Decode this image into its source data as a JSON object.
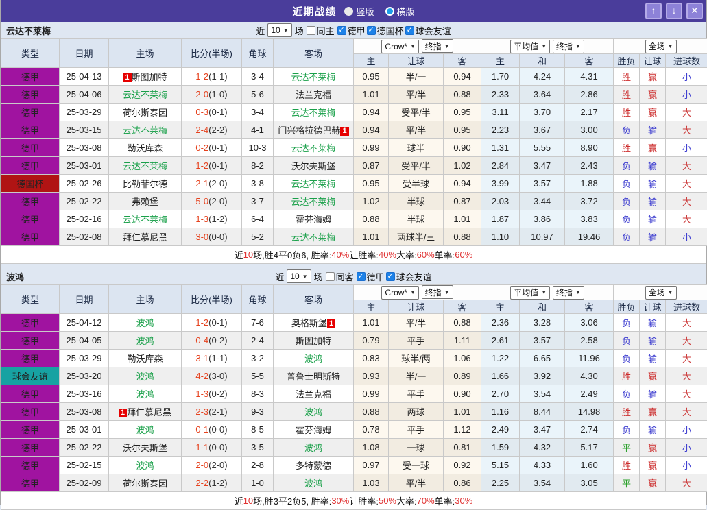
{
  "topbar": {
    "title": "近期战绩",
    "view_options": [
      {
        "label": "竖版",
        "selected": false
      },
      {
        "label": "横版",
        "selected": true
      }
    ],
    "buttons": {
      "up": "↑",
      "down": "↓",
      "close": "✕"
    }
  },
  "colors": {
    "topbar_purple": "#4a3d9b",
    "types": {
      "德甲": "#a013a0",
      "德国杯": "#b01414",
      "球会友谊": "#17a2a2"
    },
    "status": {
      "胜": "#cc2b2b",
      "赢": "#cc2b2b",
      "大": "#cc3b3b",
      "负": "#3b3bcf",
      "输": "#3b3bcf",
      "小": "#3b3bcf",
      "平": "#2ba02b"
    },
    "score_red": "#e6421e",
    "team_green": "#19a049",
    "summary_red": "#e03333",
    "checkbox_blue": "#1e82e8"
  },
  "sections": [
    {
      "team": "云达不莱梅",
      "filter": {
        "near_label": "近",
        "games_value": "10",
        "games_label": "场",
        "same_label": "同主",
        "same_checked": false,
        "leagues": [
          {
            "label": "德甲",
            "checked": true
          },
          {
            "label": "德国杯",
            "checked": true
          },
          {
            "label": "球会友谊",
            "checked": true
          }
        ]
      },
      "header": {
        "cols": [
          "类型",
          "日期",
          "主场",
          "比分(半场)",
          "角球",
          "客场"
        ],
        "crow_select": "Crow*",
        "crow_final": "终指",
        "crow_cols": [
          "主",
          "让球",
          "客"
        ],
        "avg_select": "平均值",
        "avg_final": "终指",
        "avg_cols": [
          "主",
          "和",
          "客"
        ],
        "full_select": "全场",
        "result_cols": [
          "胜负",
          "让球",
          "进球数"
        ]
      },
      "rows": [
        {
          "type": "德甲",
          "date": "25-04-13",
          "home": "斯图加特",
          "hb": "1",
          "hbs": "l",
          "hg": false,
          "score": "1-2",
          "half": "(1-1)",
          "corner": "3-4",
          "away": "云达不莱梅",
          "ag": true,
          "odds": [
            "0.95",
            "半/一",
            "0.94"
          ],
          "avg": [
            "1.70",
            "4.24",
            "4.31"
          ],
          "res": [
            "胜",
            "赢",
            "小"
          ]
        },
        {
          "type": "德甲",
          "date": "25-04-06",
          "home": "云达不莱梅",
          "hg": true,
          "score": "2-0",
          "half": "(1-0)",
          "corner": "5-6",
          "away": "法兰克福",
          "ag": false,
          "odds": [
            "1.01",
            "平/半",
            "0.88"
          ],
          "avg": [
            "2.33",
            "3.64",
            "2.86"
          ],
          "res": [
            "胜",
            "赢",
            "小"
          ]
        },
        {
          "type": "德甲",
          "date": "25-03-29",
          "home": "荷尔斯泰因",
          "hg": false,
          "score": "0-3",
          "half": "(0-1)",
          "corner": "3-4",
          "away": "云达不莱梅",
          "ag": true,
          "odds": [
            "0.94",
            "受平/半",
            "0.95"
          ],
          "avg": [
            "3.11",
            "3.70",
            "2.17"
          ],
          "res": [
            "胜",
            "赢",
            "大"
          ]
        },
        {
          "type": "德甲",
          "date": "25-03-15",
          "home": "云达不莱梅",
          "hg": true,
          "score": "2-4",
          "half": "(2-2)",
          "corner": "4-1",
          "away": "门兴格拉德巴赫",
          "ab": "1",
          "abs": "r",
          "ag": false,
          "odds": [
            "0.94",
            "平/半",
            "0.95"
          ],
          "avg": [
            "2.23",
            "3.67",
            "3.00"
          ],
          "res": [
            "负",
            "输",
            "大"
          ]
        },
        {
          "type": "德甲",
          "date": "25-03-08",
          "home": "勒沃库森",
          "hg": false,
          "score": "0-2",
          "half": "(0-1)",
          "corner": "10-3",
          "away": "云达不莱梅",
          "ag": true,
          "odds": [
            "0.99",
            "球半",
            "0.90"
          ],
          "avg": [
            "1.31",
            "5.55",
            "8.90"
          ],
          "res": [
            "胜",
            "赢",
            "小"
          ]
        },
        {
          "type": "德甲",
          "date": "25-03-01",
          "home": "云达不莱梅",
          "hg": true,
          "score": "1-2",
          "half": "(0-1)",
          "corner": "8-2",
          "away": "沃尔夫斯堡",
          "ag": false,
          "odds": [
            "0.87",
            "受平/半",
            "1.02"
          ],
          "avg": [
            "2.84",
            "3.47",
            "2.43"
          ],
          "res": [
            "负",
            "输",
            "大"
          ]
        },
        {
          "type": "德国杯",
          "date": "25-02-26",
          "home": "比勒菲尔德",
          "hg": false,
          "score": "2-1",
          "half": "(2-0)",
          "corner": "3-8",
          "away": "云达不莱梅",
          "ag": true,
          "odds": [
            "0.95",
            "受半球",
            "0.94"
          ],
          "avg": [
            "3.99",
            "3.57",
            "1.88"
          ],
          "res": [
            "负",
            "输",
            "大"
          ]
        },
        {
          "type": "德甲",
          "date": "25-02-22",
          "home": "弗赖堡",
          "hg": false,
          "score": "5-0",
          "half": "(2-0)",
          "corner": "3-7",
          "away": "云达不莱梅",
          "ag": true,
          "odds": [
            "1.02",
            "半球",
            "0.87"
          ],
          "avg": [
            "2.03",
            "3.44",
            "3.72"
          ],
          "res": [
            "负",
            "输",
            "大"
          ]
        },
        {
          "type": "德甲",
          "date": "25-02-16",
          "home": "云达不莱梅",
          "hg": true,
          "score": "1-3",
          "half": "(1-2)",
          "corner": "6-4",
          "away": "霍芬海姆",
          "ag": false,
          "odds": [
            "0.88",
            "半球",
            "1.01"
          ],
          "avg": [
            "1.87",
            "3.86",
            "3.83"
          ],
          "res": [
            "负",
            "输",
            "大"
          ]
        },
        {
          "type": "德甲",
          "date": "25-02-08",
          "home": "拜仁慕尼黑",
          "hg": false,
          "score": "3-0",
          "half": "(0-0)",
          "corner": "5-2",
          "away": "云达不莱梅",
          "ag": true,
          "odds": [
            "1.01",
            "两球半/三",
            "0.88"
          ],
          "avg": [
            "1.10",
            "10.97",
            "19.46"
          ],
          "res": [
            "负",
            "输",
            "小"
          ]
        }
      ],
      "summary": [
        {
          "t": "近"
        },
        {
          "t": "10",
          "red": true
        },
        {
          "t": "场,胜4平0负6, 胜率:"
        },
        {
          "t": "40%",
          "red": true
        },
        {
          "t": " 让胜率:"
        },
        {
          "t": "40%",
          "red": true
        },
        {
          "t": " 大率:"
        },
        {
          "t": "60%",
          "red": true
        },
        {
          "t": " 单率:"
        },
        {
          "t": "60%",
          "red": true
        }
      ]
    },
    {
      "team": "波鸿",
      "filter": {
        "near_label": "近",
        "games_value": "10",
        "games_label": "场",
        "same_label": "同客",
        "same_checked": false,
        "leagues": [
          {
            "label": "德甲",
            "checked": true
          },
          {
            "label": "球会友谊",
            "checked": true
          }
        ]
      },
      "header": {
        "cols": [
          "类型",
          "日期",
          "主场",
          "比分(半场)",
          "角球",
          "客场"
        ],
        "crow_select": "Crow*",
        "crow_final": "终指",
        "crow_cols": [
          "主",
          "让球",
          "客"
        ],
        "avg_select": "平均值",
        "avg_final": "终指",
        "avg_cols": [
          "主",
          "和",
          "客"
        ],
        "full_select": "全场",
        "result_cols": [
          "胜负",
          "让球",
          "进球数"
        ]
      },
      "rows": [
        {
          "type": "德甲",
          "date": "25-04-12",
          "home": "波鸿",
          "hg": true,
          "score": "1-2",
          "half": "(0-1)",
          "corner": "7-6",
          "away": "奥格斯堡",
          "ab": "1",
          "abs": "r",
          "ag": false,
          "odds": [
            "1.01",
            "平/半",
            "0.88"
          ],
          "avg": [
            "2.36",
            "3.28",
            "3.06"
          ],
          "res": [
            "负",
            "输",
            "大"
          ]
        },
        {
          "type": "德甲",
          "date": "25-04-05",
          "home": "波鸿",
          "hg": true,
          "score": "0-4",
          "half": "(0-2)",
          "corner": "2-4",
          "away": "斯图加特",
          "ag": false,
          "odds": [
            "0.79",
            "平手",
            "1.11"
          ],
          "avg": [
            "2.61",
            "3.57",
            "2.58"
          ],
          "res": [
            "负",
            "输",
            "大"
          ]
        },
        {
          "type": "德甲",
          "date": "25-03-29",
          "home": "勒沃库森",
          "hg": false,
          "score": "3-1",
          "half": "(1-1)",
          "corner": "3-2",
          "away": "波鸿",
          "ag": true,
          "odds": [
            "0.83",
            "球半/两",
            "1.06"
          ],
          "avg": [
            "1.22",
            "6.65",
            "11.96"
          ],
          "res": [
            "负",
            "输",
            "大"
          ]
        },
        {
          "type": "球会友谊",
          "date": "25-03-20",
          "home": "波鸿",
          "hg": true,
          "score": "4-2",
          "half": "(3-0)",
          "corner": "5-5",
          "away": "普鲁士明斯特",
          "ag": false,
          "odds": [
            "0.93",
            "半/一",
            "0.89"
          ],
          "avg": [
            "1.66",
            "3.92",
            "4.30"
          ],
          "res": [
            "胜",
            "赢",
            "大"
          ]
        },
        {
          "type": "德甲",
          "date": "25-03-16",
          "home": "波鸿",
          "hg": true,
          "score": "1-3",
          "half": "(0-2)",
          "corner": "8-3",
          "away": "法兰克福",
          "ag": false,
          "odds": [
            "0.99",
            "平手",
            "0.90"
          ],
          "avg": [
            "2.70",
            "3.54",
            "2.49"
          ],
          "res": [
            "负",
            "输",
            "大"
          ]
        },
        {
          "type": "德甲",
          "date": "25-03-08",
          "home": "拜仁慕尼黑",
          "hb": "1",
          "hbs": "l",
          "hg": false,
          "score": "2-3",
          "half": "(2-1)",
          "corner": "9-3",
          "away": "波鸿",
          "ag": true,
          "odds": [
            "0.88",
            "两球",
            "1.01"
          ],
          "avg": [
            "1.16",
            "8.44",
            "14.98"
          ],
          "res": [
            "胜",
            "赢",
            "大"
          ]
        },
        {
          "type": "德甲",
          "date": "25-03-01",
          "home": "波鸿",
          "hg": true,
          "score": "0-1",
          "half": "(0-0)",
          "corner": "8-5",
          "away": "霍芬海姆",
          "ag": false,
          "odds": [
            "0.78",
            "平手",
            "1.12"
          ],
          "avg": [
            "2.49",
            "3.47",
            "2.74"
          ],
          "res": [
            "负",
            "输",
            "小"
          ]
        },
        {
          "type": "德甲",
          "date": "25-02-22",
          "home": "沃尔夫斯堡",
          "hg": false,
          "score": "1-1",
          "half": "(0-0)",
          "corner": "3-5",
          "away": "波鸿",
          "ag": true,
          "odds": [
            "1.08",
            "一球",
            "0.81"
          ],
          "avg": [
            "1.59",
            "4.32",
            "5.17"
          ],
          "res": [
            "平",
            "赢",
            "小"
          ]
        },
        {
          "type": "德甲",
          "date": "25-02-15",
          "home": "波鸿",
          "hg": true,
          "score": "2-0",
          "half": "(2-0)",
          "corner": "2-8",
          "away": "多特蒙德",
          "ag": false,
          "odds": [
            "0.97",
            "受一球",
            "0.92"
          ],
          "avg": [
            "5.15",
            "4.33",
            "1.60"
          ],
          "res": [
            "胜",
            "赢",
            "小"
          ]
        },
        {
          "type": "德甲",
          "date": "25-02-09",
          "home": "荷尔斯泰因",
          "hg": false,
          "score": "2-2",
          "half": "(1-2)",
          "corner": "1-0",
          "away": "波鸿",
          "ag": true,
          "odds": [
            "1.03",
            "平/半",
            "0.86"
          ],
          "avg": [
            "2.25",
            "3.54",
            "3.05"
          ],
          "res": [
            "平",
            "赢",
            "大"
          ]
        }
      ],
      "summary": [
        {
          "t": "近"
        },
        {
          "t": "10",
          "red": true
        },
        {
          "t": "场,胜3平2负5, 胜率:"
        },
        {
          "t": "30%",
          "red": true
        },
        {
          "t": " 让胜率:"
        },
        {
          "t": "50%",
          "red": true
        },
        {
          "t": " 大率:"
        },
        {
          "t": "70%",
          "red": true
        },
        {
          "t": " 单率:"
        },
        {
          "t": "30%",
          "red": true
        }
      ]
    }
  ]
}
